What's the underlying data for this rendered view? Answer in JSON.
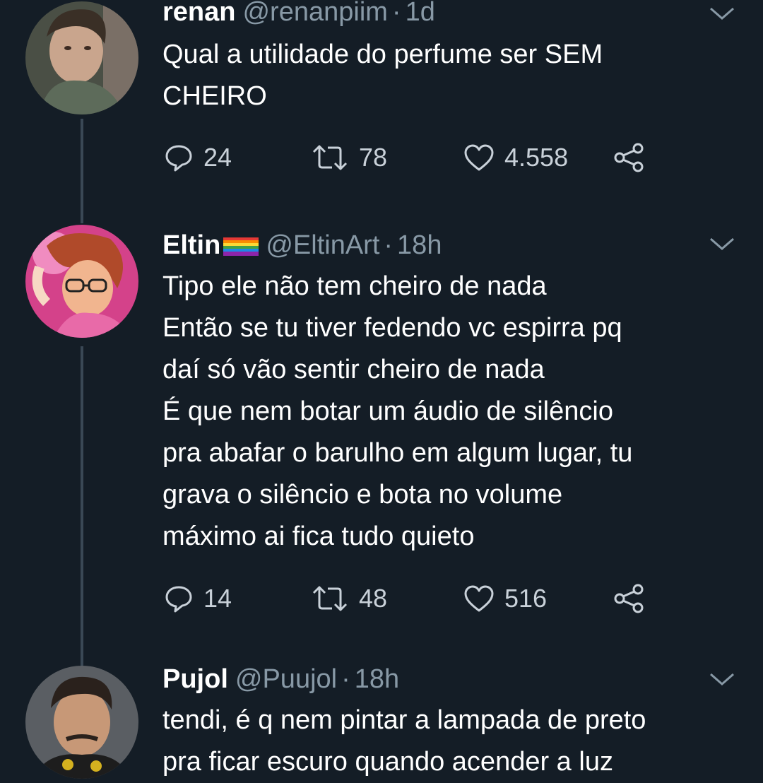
{
  "tweets": [
    {
      "name": "renan",
      "handle": "@renanpiim",
      "separator": "·",
      "time": "1d",
      "lines": [
        "Qual a utilidade do perfume ser SEM",
        "CHEIRO"
      ],
      "replies": "24",
      "retweets": "78",
      "likes": "4.558"
    },
    {
      "name": "Eltin",
      "handle": "@EltinArt",
      "separator": "·",
      "time": "18h",
      "lines": [
        "Tipo ele não tem cheiro de nada",
        "Então se tu tiver fedendo vc espirra pq",
        "daí só vão sentir cheiro de nada",
        "É que nem botar um áudio de silêncio",
        "pra abafar o barulho em algum lugar, tu",
        "grava o silêncio e bota no volume",
        "máximo ai fica tudo quieto"
      ],
      "replies": "14",
      "retweets": "48",
      "likes": "516"
    },
    {
      "name": "Pujol",
      "handle": "@Puujol",
      "separator": "·",
      "time": "18h",
      "lines": [
        "tendi, é q nem pintar a lampada de preto",
        "pra ficar escuro quando acender a luz"
      ]
    }
  ],
  "icons": {
    "reply": "reply-icon",
    "retweet": "retweet-icon",
    "like": "heart-icon",
    "share": "share-icon",
    "more": "chevron-down-icon"
  },
  "colors": {
    "background": "#141d26",
    "text": "#ffffff",
    "muted": "#8899a6",
    "thread_line": "#3a4855"
  }
}
